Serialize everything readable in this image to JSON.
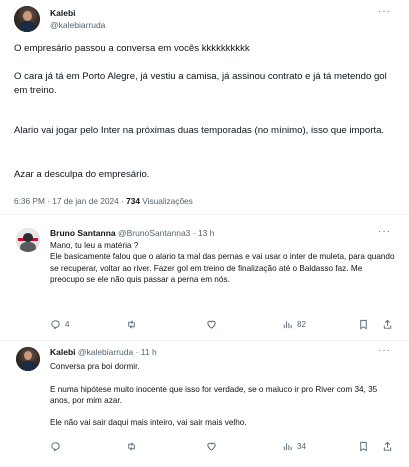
{
  "main_tweet": {
    "author_name": "Kalebi",
    "author_handle": "@kalebiarruda",
    "more_label": "···",
    "paragraphs": [
      "O empresário passou a conversa em vocês kkkkkkkkkk",
      "O cara já tá em Porto Alegre, já vestiu a camisa, já assinou contrato e já tá metendo gol em treino.",
      "Alario vai jogar pelo Inter na próximas duas temporadas (no mínimo), isso que importa.",
      "Azar a desculpa do empresário."
    ],
    "time": "6:36 PM · 17 de jan de 2024 · ",
    "views_count": "734",
    "views_label": " Visualizações"
  },
  "replies": [
    {
      "author_name": "Bruno Santanna",
      "author_handle": "@BrunoSantanna3",
      "time": " · 13 h",
      "more_label": "···",
      "text": "Mano, tu leu a matéria ?\nEle basicamente falou que o alario ta mal das pernas e vai usar o inter de muleta, para quando se recuperar, voltar ao river. Fazer gol em treino de finalização até o Baldasso faz. Me preocupo se ele não quis passar a perna em nós.",
      "replies_count": "4",
      "retweets_count": "",
      "likes_count": "",
      "views_count": "82"
    },
    {
      "author_name": "Kalebi",
      "author_handle": "@kalebiarruda",
      "time": " · 11 h",
      "more_label": "···",
      "text": "Conversa pra boi dormir.\n\nE numa hipótese muito inocente que isso for verdade, se o maluco ir pro River com 34, 35 anos, por mim azar.\n\nEle não vai sair daqui mais inteiro, vai sair mais velho.",
      "replies_count": "",
      "retweets_count": "",
      "likes_count": "",
      "views_count": "34"
    }
  ],
  "icons": {
    "reply": "reply-icon",
    "retweet": "retweet-icon",
    "like": "heart-icon",
    "views": "views-icon",
    "bookmark": "bookmark-icon",
    "share": "share-icon"
  },
  "colors": {
    "text": "#0f1419",
    "secondary": "#536471",
    "divider": "#eff3f4"
  }
}
